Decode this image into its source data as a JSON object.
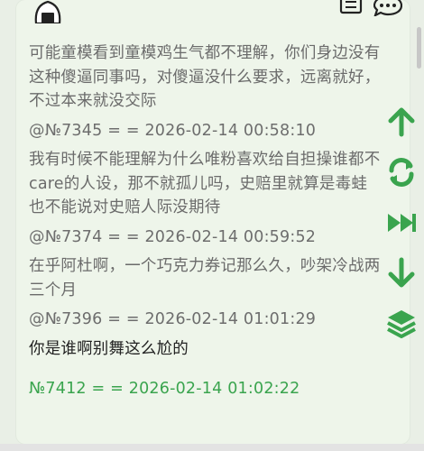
{
  "icons": {
    "avatar": "onigiri-avatar-icon",
    "doc": "document-icon",
    "chat": "chat-bubble-icon",
    "up": "arrow-up-icon",
    "refresh": "refresh-icon",
    "fast_forward": "fast-forward-icon",
    "down": "arrow-down-icon",
    "layers": "layers-icon"
  },
  "colors": {
    "accent": "#3aa44e",
    "background": "#eef5ea",
    "text": "#6b6b6b"
  },
  "thread": {
    "intro": [
      "可能童模看到童模鸡生气都不理解，你们身边没有",
      "这种傻逼同事吗，对傻逼没什么要求，远离就好，",
      "不过本来就没交际"
    ],
    "posts": [
      {
        "meta": "@№7345 = = 2026-02-14 00:58:10",
        "lines": [
          "我有时候不能理解为什么唯粉喜欢给自担操谁都不",
          "care的人设，那不就孤儿吗，史赔里就算是毒蛙",
          "也不能说对史赔人际没期待"
        ]
      },
      {
        "meta": "@№7374 = = 2026-02-14 00:59:52",
        "lines": [
          "在乎阿杜啊，一个巧克力券记那么久，吵架冷战两",
          "三个月"
        ]
      },
      {
        "meta": "@№7396 = = 2026-02-14 01:01:29",
        "lines": [
          "你是谁啊别舞这么尬的"
        ]
      }
    ],
    "latest_meta": "№7412 = = 2026-02-14 01:02:22"
  }
}
